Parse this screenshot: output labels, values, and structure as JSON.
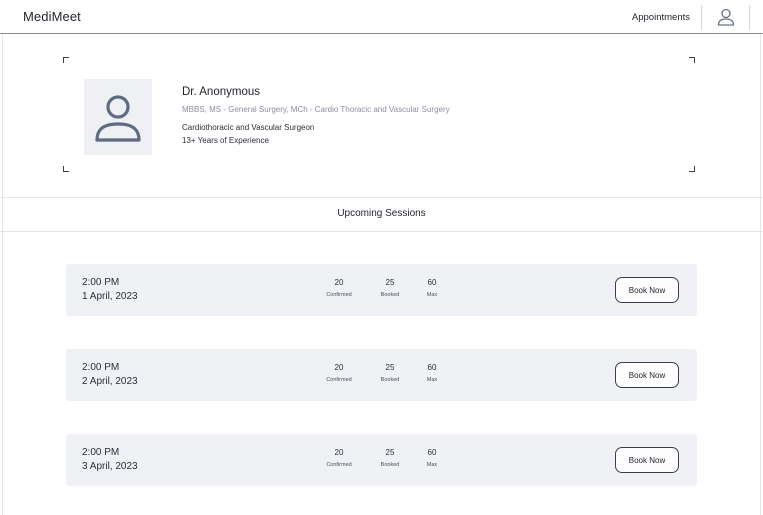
{
  "header": {
    "brand": "MediMeet",
    "nav_link": "Appointments",
    "avatar_icon": "user-icon"
  },
  "doctor": {
    "photo_icon": "user-placeholder-icon",
    "name": "Dr. Anonymous",
    "qualifications": "MBBS, MS - General Surgery, MCh - Cardio Thoracic and Vascular Surgery",
    "specialty": "Cardiothoracic and Vascular Surgeon",
    "experience": "13+ Years of Experience"
  },
  "sessions_section": {
    "title": "Upcoming Sessions",
    "stat_labels": {
      "confirmed": "Confirmed",
      "booked": "Booked",
      "max": "Max"
    },
    "book_label": "Book Now",
    "items": [
      {
        "time": "2:00 PM",
        "date": "1 April, 2023",
        "confirmed": "20",
        "booked": "25",
        "max": "60"
      },
      {
        "time": "2:00 PM",
        "date": "2 April, 2023",
        "confirmed": "20",
        "booked": "25",
        "max": "60"
      },
      {
        "time": "2:00 PM",
        "date": "3 April, 2023",
        "confirmed": "20",
        "booked": "25",
        "max": "60"
      }
    ]
  }
}
